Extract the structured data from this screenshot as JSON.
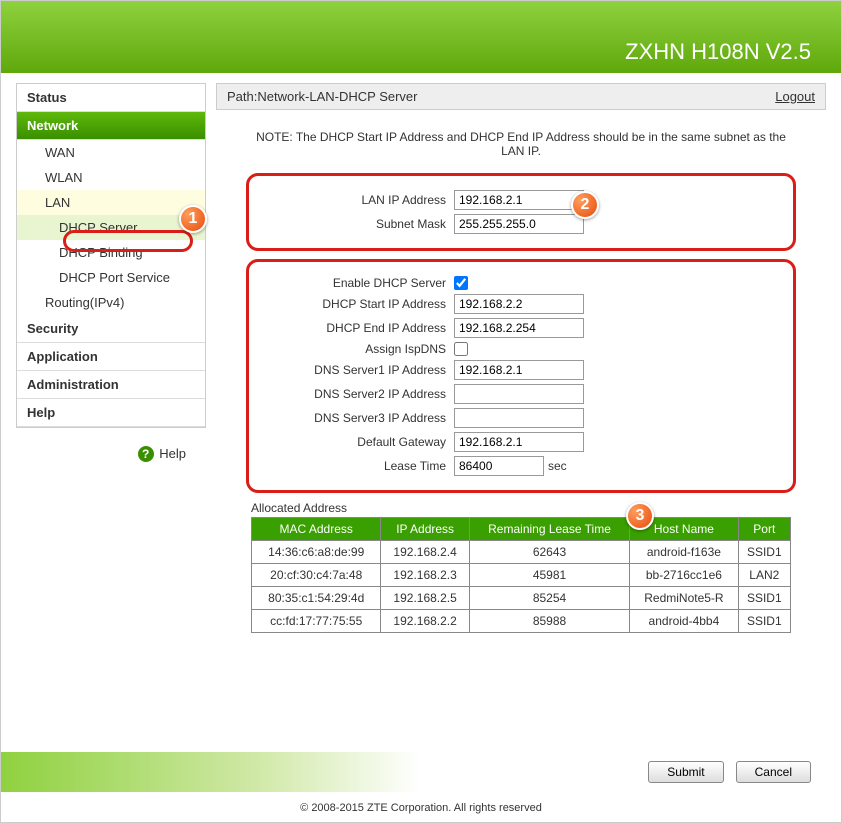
{
  "header": {
    "title": "ZXHN H108N V2.5"
  },
  "path": {
    "prefix": "Path:",
    "value": "Network-LAN-DHCP Server",
    "logout": "Logout"
  },
  "sidebar": {
    "status": "Status",
    "network": "Network",
    "wan": "WAN",
    "wlan": "WLAN",
    "lan": "LAN",
    "dhcp_server": "DHCP Server",
    "dhcp_binding": "DHCP Binding",
    "dhcp_port": "DHCP Port Service",
    "routing": "Routing(IPv4)",
    "security": "Security",
    "application": "Application",
    "administration": "Administration",
    "help": "Help",
    "help_link": "Help"
  },
  "note": "NOTE: The DHCP Start IP Address and DHCP End IP Address should be in the same subnet as the LAN IP.",
  "form1": {
    "lan_ip_label": "LAN IP Address",
    "lan_ip_value": "192.168.2.1",
    "subnet_label": "Subnet Mask",
    "subnet_value": "255.255.255.0"
  },
  "form2": {
    "enable_label": "Enable DHCP Server",
    "enable_checked": true,
    "start_label": "DHCP Start IP Address",
    "start_value": "192.168.2.2",
    "end_label": "DHCP End IP Address",
    "end_value": "192.168.2.254",
    "ispdns_label": "Assign IspDNS",
    "ispdns_checked": false,
    "dns1_label": "DNS Server1 IP Address",
    "dns1_value": "192.168.2.1",
    "dns2_label": "DNS Server2 IP Address",
    "dns2_value": "",
    "dns3_label": "DNS Server3 IP Address",
    "dns3_value": "",
    "gw_label": "Default Gateway",
    "gw_value": "192.168.2.1",
    "lease_label": "Lease Time",
    "lease_value": "86400",
    "lease_unit": "sec"
  },
  "alloc": {
    "title": "Allocated Address",
    "headers": {
      "mac": "MAC Address",
      "ip": "IP Address",
      "time": "Remaining Lease Time",
      "host": "Host Name",
      "port": "Port"
    },
    "rows": [
      {
        "mac": "14:36:c6:a8:de:99",
        "ip": "192.168.2.4",
        "time": "62643",
        "host": "android-f163e",
        "port": "SSID1"
      },
      {
        "mac": "20:cf:30:c4:7a:48",
        "ip": "192.168.2.3",
        "time": "45981",
        "host": "bb-2716cc1e6",
        "port": "LAN2"
      },
      {
        "mac": "80:35:c1:54:29:4d",
        "ip": "192.168.2.5",
        "time": "85254",
        "host": "RedmiNote5-R",
        "port": "SSID1"
      },
      {
        "mac": "cc:fd:17:77:75:55",
        "ip": "192.168.2.2",
        "time": "85988",
        "host": "android-4bb4",
        "port": "SSID1"
      }
    ]
  },
  "buttons": {
    "submit": "Submit",
    "cancel": "Cancel"
  },
  "copyright": "© 2008-2015 ZTE Corporation. All rights reserved",
  "callouts": {
    "c1": "1",
    "c2": "2",
    "c3": "3"
  }
}
